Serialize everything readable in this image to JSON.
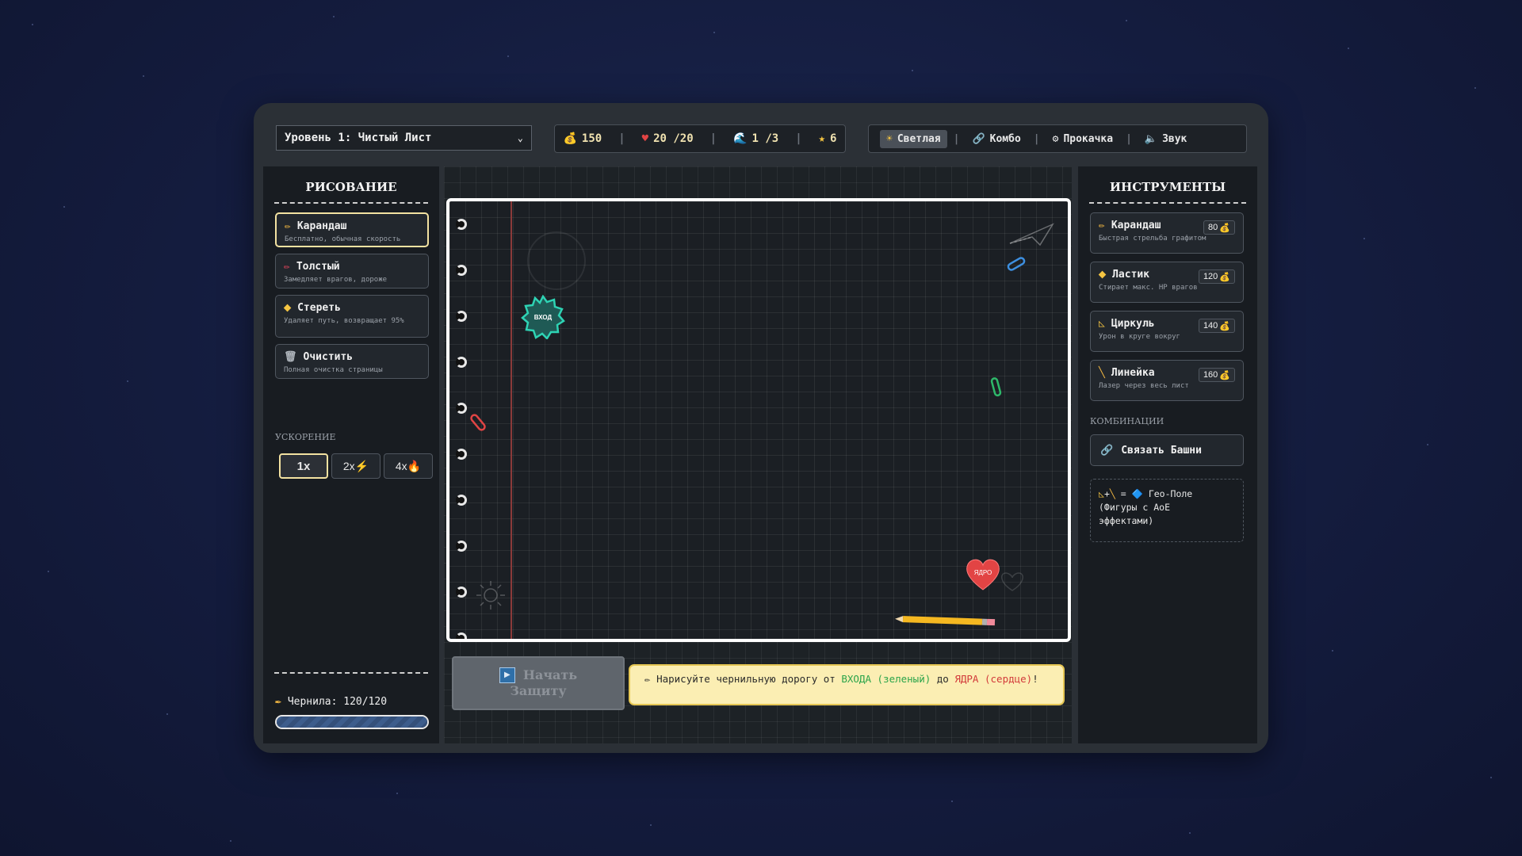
{
  "header": {
    "level_select": "Уровень 1: Чистый Лист",
    "stats": {
      "coins": "150",
      "lives": "20 /20",
      "waves": "1 /3",
      "stars": "6"
    },
    "menu": {
      "theme": "Светлая",
      "combo": "Комбо",
      "upgrade": "Прокачка",
      "sound": "Звук"
    }
  },
  "left": {
    "title": "РИСОВАНИЕ",
    "tools": [
      {
        "name": "Карандаш",
        "desc": "Бесплатно, обычная скорость"
      },
      {
        "name": "Толстый",
        "desc": "Замедляет врагов, дороже"
      },
      {
        "name": "Стереть",
        "desc": "Удаляет путь, возвращает 95%"
      },
      {
        "name": "Очистить",
        "desc": "Полная очистка страницы"
      }
    ],
    "speed_label": "УСКОРЕНИЕ",
    "speeds": [
      "1x",
      "2x",
      "4x"
    ],
    "ink_label": "Чернила: 120/120",
    "ink_fraction": 1.0
  },
  "canvas": {
    "entry_label": "ВХОД",
    "core_label": "ЯДРО"
  },
  "bottom": {
    "start_line1": "Начать",
    "start_line2": "Защиту",
    "hint_pre": "Нарисуйте чернильную дорогу от ",
    "hint_entry": "ВХОДА (зеленый)",
    "hint_mid": " до ",
    "hint_core": "ЯДРА (сердце)",
    "hint_post": "!"
  },
  "right": {
    "title": "ИНСТРУМЕНТЫ",
    "towers": [
      {
        "name": "Карандаш",
        "desc": "Быстрая стрельба графитом",
        "price": "80"
      },
      {
        "name": "Ластик",
        "desc": "Стирает макс. HP врагов",
        "price": "120"
      },
      {
        "name": "Циркуль",
        "desc": "Урон в круге вокруг",
        "price": "140"
      },
      {
        "name": "Линейка",
        "desc": "Лазер через весь лист",
        "price": "160"
      }
    ],
    "combos_label": "КОМБИНАЦИИ",
    "combo_button": "Связать Башни",
    "geo_line1": "= 🔷 Гео-Поле",
    "geo_line2": "(Фигуры с AoE",
    "geo_line3": "эффектами)"
  },
  "colors": {
    "accent": "#f3e2a1",
    "panel": "#181c21",
    "hint_bg": "#fbeeb3",
    "entry": "#2ed3b4",
    "core": "#e24444"
  }
}
